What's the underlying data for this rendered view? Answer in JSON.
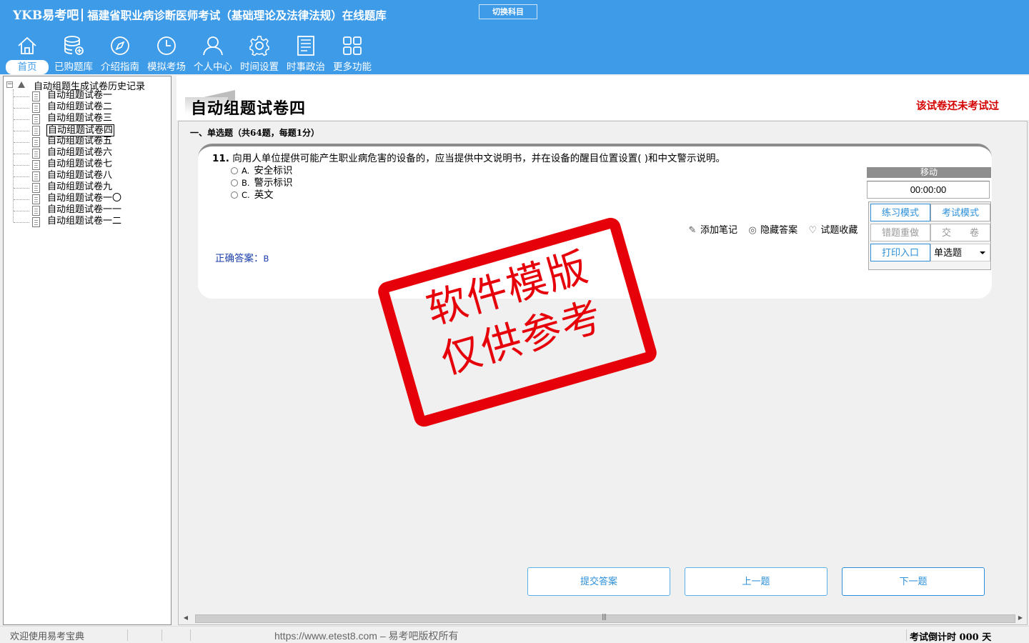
{
  "app": {
    "logo": "YKB易考吧",
    "title": "福建省职业病诊断医师考试（基础理论及法律法规）在线题库",
    "switch_label": "切换科目"
  },
  "nav": [
    {
      "label": "首页",
      "icon": "home-icon",
      "active": true
    },
    {
      "label": "已购题库",
      "icon": "database-icon"
    },
    {
      "label": "介绍指南",
      "icon": "compass-icon"
    },
    {
      "label": "模拟考场",
      "icon": "clock-icon"
    },
    {
      "label": "个人中心",
      "icon": "user-icon"
    },
    {
      "label": "时间设置",
      "icon": "gear-icon"
    },
    {
      "label": "时事政治",
      "icon": "newspaper-icon"
    },
    {
      "label": "更多功能",
      "icon": "grid-icon"
    }
  ],
  "tree": {
    "root_label": "自动组题生成试卷历史记录",
    "items": [
      "自动组题试卷一",
      "自动组题试卷二",
      "自动组题试卷三",
      "自动组题试卷四",
      "自动组题试卷五",
      "自动组题试卷六",
      "自动组题试卷七",
      "自动组题试卷八",
      "自动组题试卷九",
      "自动组题试卷一〇",
      "自动组题试卷一一",
      "自动组题试卷一二"
    ],
    "selected": "自动组题试卷四"
  },
  "paper": {
    "title": "自动组题试卷四",
    "status": "该试卷还未考试过",
    "section_header": "一、单选题（共64题，每题1分）"
  },
  "question": {
    "number": "11.",
    "text": "向用人单位提供可能产生职业病危害的设备的，应当提供中文说明书，并在设备的醒目位置设置( )和中文警示说明。",
    "options": [
      {
        "key": "A.",
        "text": "安全标识"
      },
      {
        "key": "B.",
        "text": "警示标识"
      },
      {
        "key": "C.",
        "text": "英文"
      }
    ],
    "answer_label": "正确答案：",
    "answer_value": "B"
  },
  "actions": {
    "add_note": "添加笔记",
    "hide_answer": "隐藏答案",
    "favorite": "试题收藏"
  },
  "side_panel": {
    "move_label": "移动",
    "timer": "00:00:00",
    "practice_mode": "练习模式",
    "exam_mode": "考试模式",
    "redo_wrong": "错题重做",
    "submit_paper": "交　　卷",
    "print_entry": "打印入口",
    "question_type": "单选题"
  },
  "stamp": {
    "line1": "软件模版",
    "line2": "仅供参考"
  },
  "buttons": {
    "submit_answer": "提交答案",
    "prev": "上一题",
    "next": "下一题"
  },
  "status_bar": {
    "welcome": "欢迎使用易考宝典",
    "copyright": "https://www.etest8.com – 易考吧版权所有",
    "countdown": "考试倒计时 000 天"
  },
  "colors": {
    "header_blue": "#3d9be8",
    "accent_blue": "#2c8fd8",
    "status_red": "#d40000",
    "stamp_red": "#e6000a"
  }
}
